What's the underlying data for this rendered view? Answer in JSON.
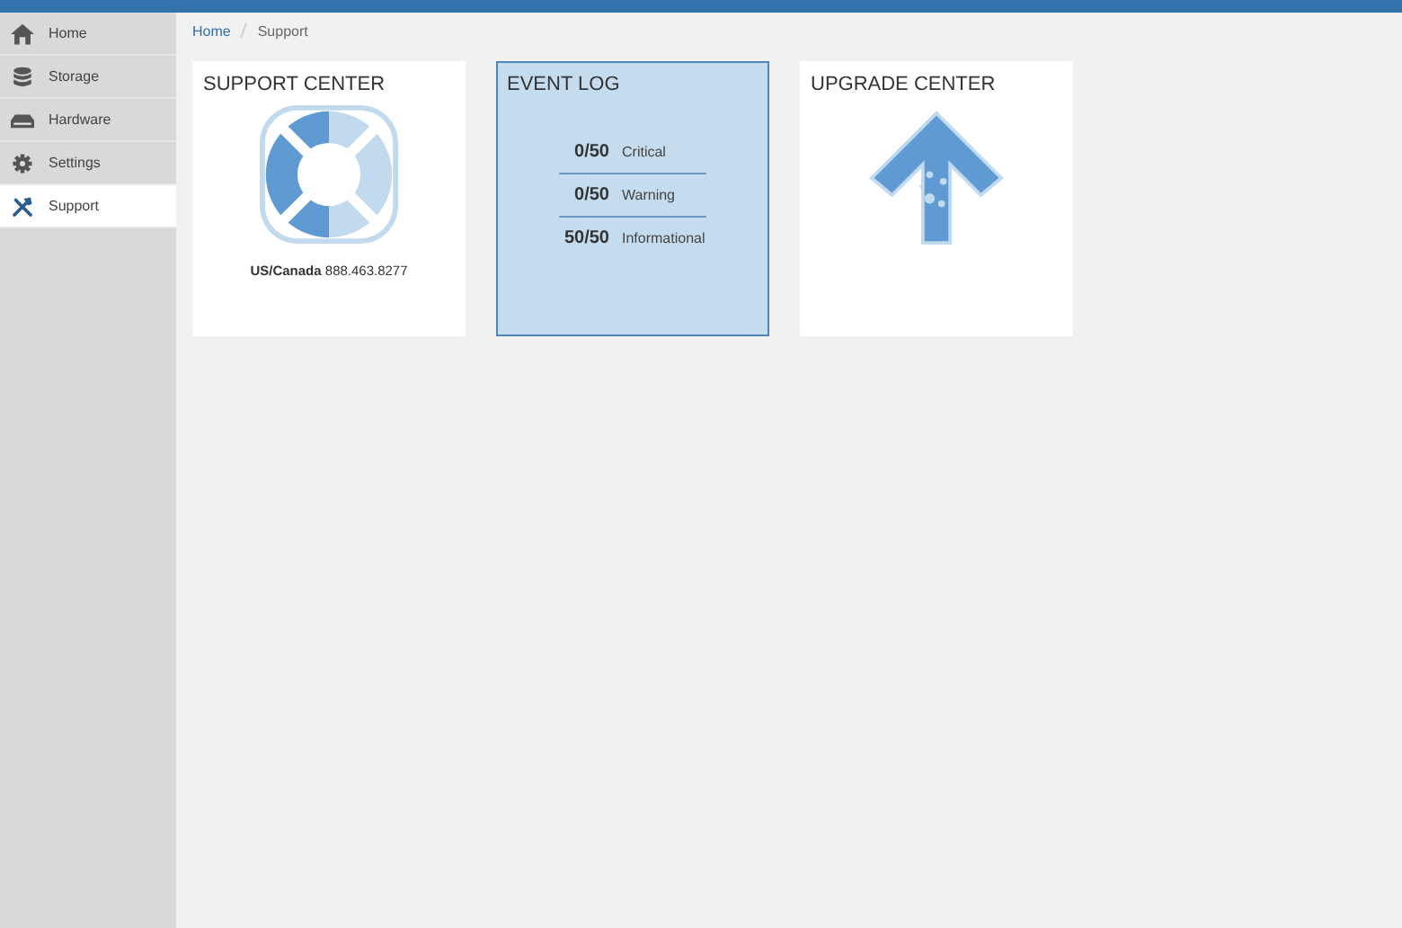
{
  "sidebar": {
    "items": [
      {
        "label": "Home",
        "kind": "home",
        "selected": false
      },
      {
        "label": "Storage",
        "kind": "storage",
        "selected": false
      },
      {
        "label": "Hardware",
        "kind": "hardware",
        "selected": false
      },
      {
        "label": "Settings",
        "kind": "settings",
        "selected": false
      },
      {
        "label": "Support",
        "kind": "support",
        "selected": true
      }
    ]
  },
  "breadcrumb": [
    {
      "label": "Home",
      "link": true
    },
    {
      "label": "Support",
      "link": false
    }
  ],
  "cards": [
    {
      "kind": "support",
      "title": "SUPPORT CENTER",
      "selected": false,
      "contact_label": "US/Canada",
      "contact_phone": "888.463.8277"
    },
    {
      "kind": "events",
      "title": "EVENT LOG",
      "selected": true,
      "rows": [
        {
          "count": "0/50",
          "label": "Critical"
        },
        {
          "count": "0/50",
          "label": "Warning"
        },
        {
          "count": "50/50",
          "label": "Informational"
        }
      ]
    },
    {
      "kind": "upgrade",
      "title": "UPGRADE CENTER",
      "selected": false
    }
  ]
}
